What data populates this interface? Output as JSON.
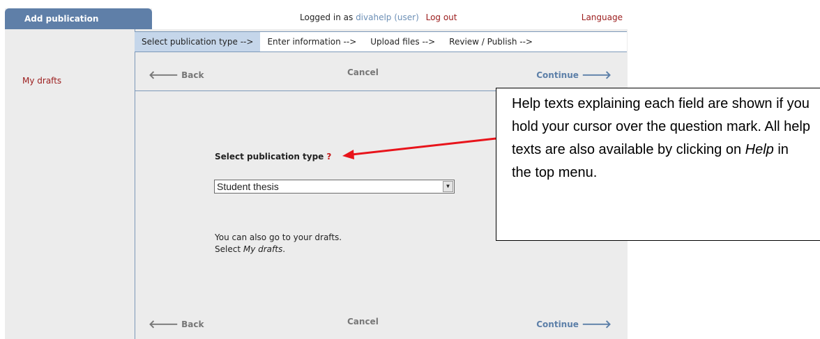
{
  "sidebar": {
    "tab_label": "Add publication",
    "items": [
      {
        "label": "My drafts"
      }
    ]
  },
  "header": {
    "logged_in_prefix": "Logged in as",
    "user": "divahelp (user)",
    "logout": "Log out",
    "language": "Language"
  },
  "steps": [
    {
      "label": "Select publication type -->",
      "active": true
    },
    {
      "label": "Enter information -->",
      "active": false
    },
    {
      "label": "Upload files -->",
      "active": false
    },
    {
      "label": "Review / Publish -->",
      "active": false
    }
  ],
  "nav": {
    "back": "Back",
    "cancel": "Cancel",
    "continue": "Continue"
  },
  "form": {
    "label": "Select publication type",
    "help_mark": "?",
    "selected_value": "Student thesis",
    "hint_line1": "You can also go to your drafts.",
    "hint_line2_prefix": "Select ",
    "hint_line2_em": "My drafts",
    "hint_line2_suffix": "."
  },
  "callout": {
    "text_before": "Help texts explaining each field are shown if you hold your cursor over the question mark. All help texts are also available by clicking on ",
    "text_em": "Help",
    "text_after": " in the top menu."
  },
  "colors": {
    "accent": "#5f7fa8",
    "link_red": "#9b1c1c",
    "annotation_arrow": "#e8141b"
  }
}
